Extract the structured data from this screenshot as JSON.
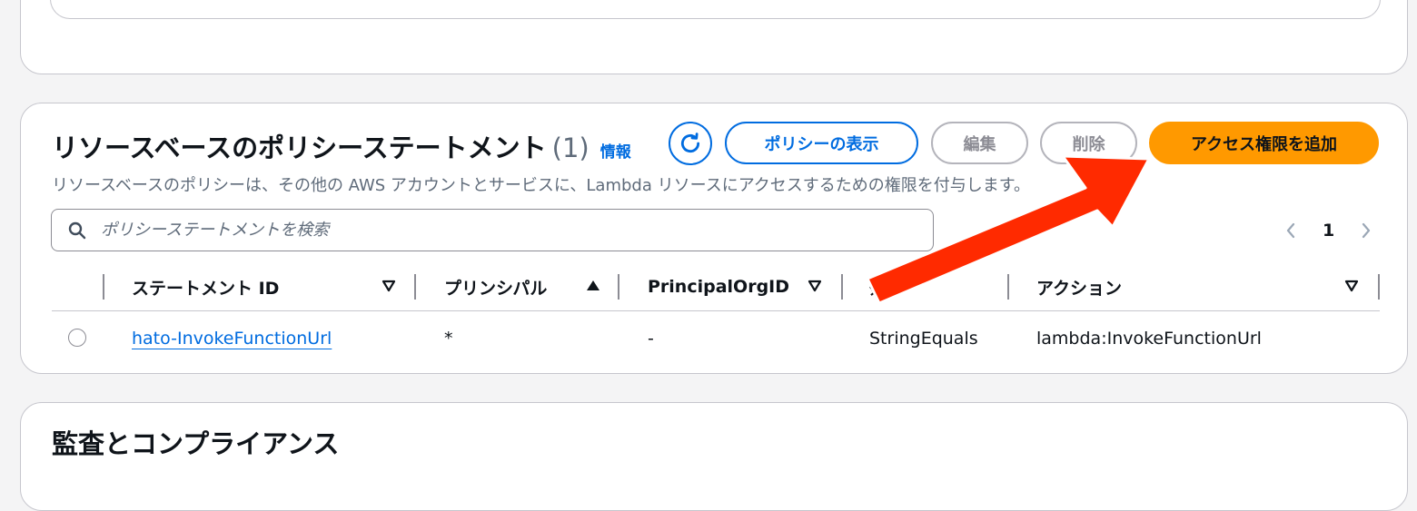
{
  "policy_section": {
    "title": "リソースベースのポリシーステートメント",
    "count": "(1)",
    "info_link": "情報",
    "description": "リソースベースのポリシーは、その他の AWS アカウントとサービスに、Lambda リソースにアクセスするための権限を付与します。",
    "buttons": {
      "view_policy": "ポリシーの表示",
      "edit": "編集",
      "delete": "削除",
      "add_permission": "アクセス権限を追加"
    },
    "search": {
      "placeholder": "ポリシーステートメントを検索",
      "value": ""
    },
    "pagination": {
      "current_page": "1"
    },
    "table": {
      "columns": [
        "ステートメント ID",
        "プリンシパル",
        "PrincipalOrgID",
        "条件",
        "アクション"
      ],
      "rows": [
        {
          "statement_id": "hato-InvokeFunctionUrl",
          "principal": "*",
          "principal_org_id": "-",
          "condition": "StringEquals",
          "action": "lambda:InvokeFunctionUrl"
        }
      ]
    }
  },
  "audit_section": {
    "title": "監査とコンプライアンス"
  },
  "colors": {
    "accent_blue": "#006ce0",
    "primary_orange": "#ff9900",
    "arrow_red": "#ff2a00",
    "disabled_gray": "#8c8c94"
  },
  "icons": [
    "refresh-icon",
    "search-icon",
    "chevron-left-icon",
    "chevron-right-icon",
    "sort-desc-icon",
    "sort-asc-icon"
  ]
}
